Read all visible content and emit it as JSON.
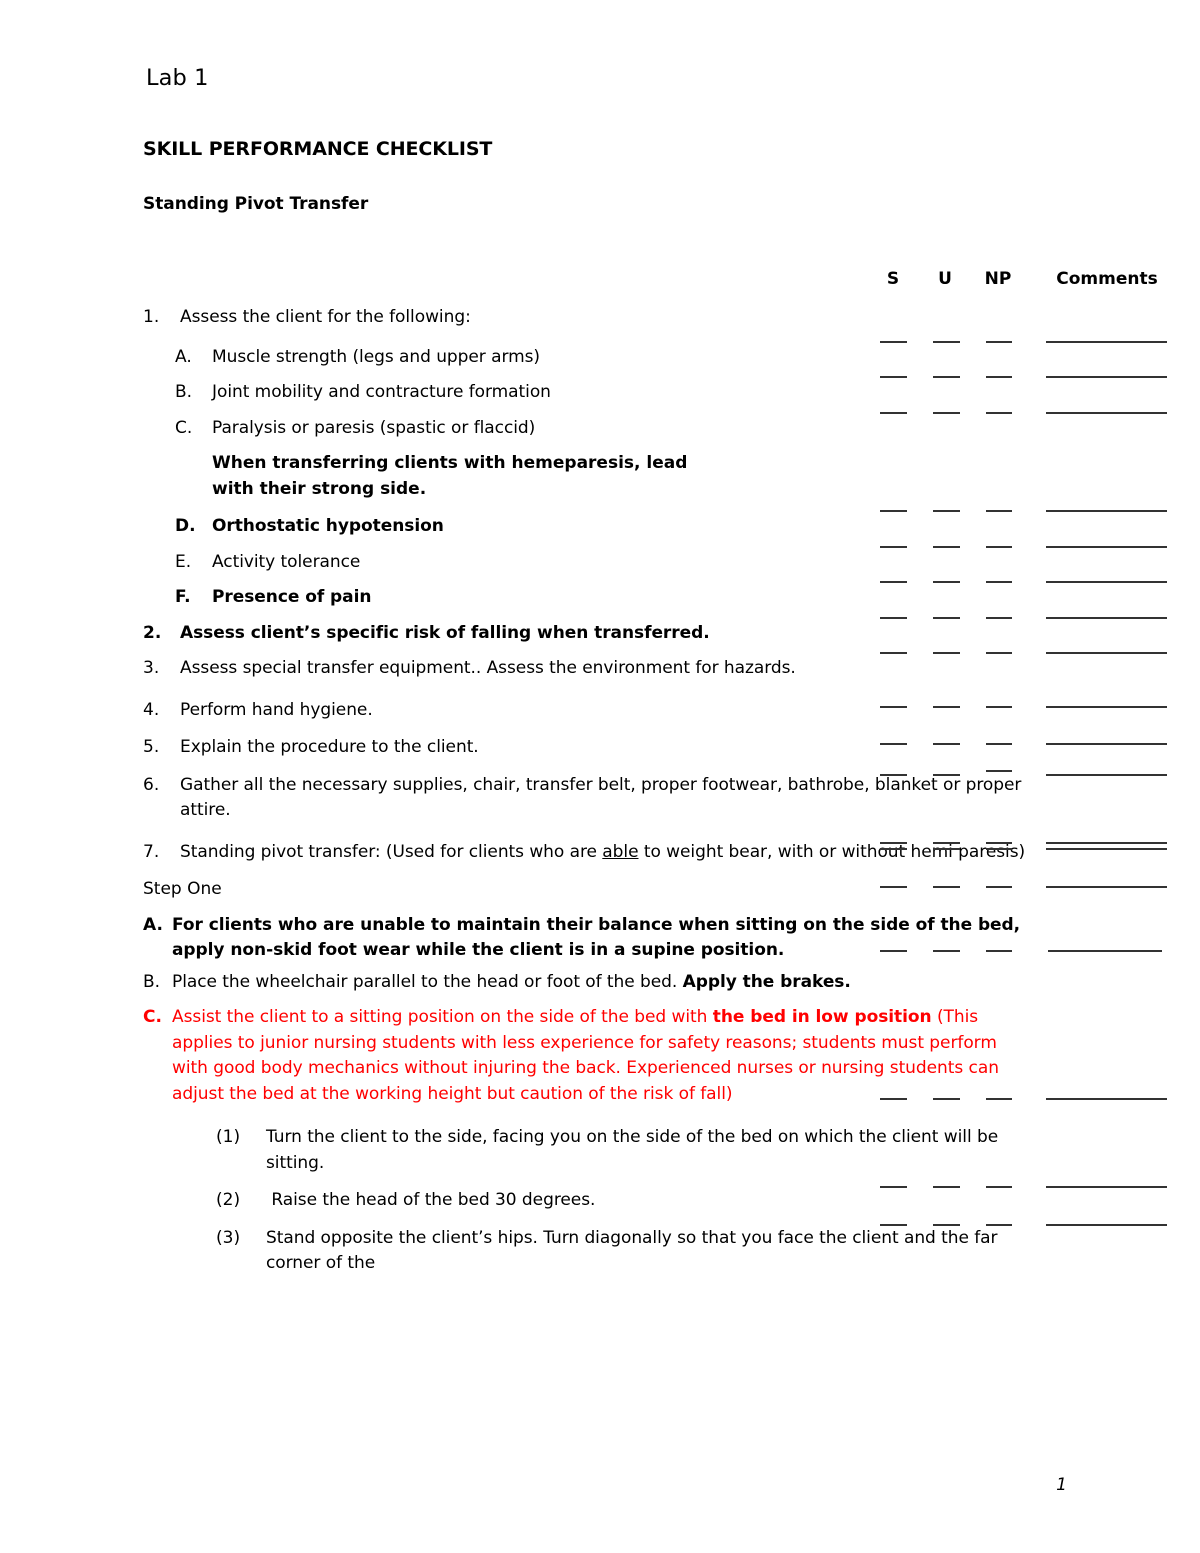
{
  "document": {
    "lab_title": "Lab 1",
    "checklist_title": "SKILL PERFORMANCE CHECKLIST",
    "skill_name": "Standing Pivot Transfer",
    "page_number": "1"
  },
  "columns": {
    "s": "S",
    "u": "U",
    "np": "NP",
    "comments": "Comments"
  },
  "colors": {
    "red_highlight": "#FF0000",
    "text": "#000000",
    "rule": "#333333"
  },
  "items": {
    "n1_marker": "1.",
    "n1_text": "Assess the client for the following:",
    "a_marker": "A.",
    "a_text": "Muscle strength (legs and upper arms)",
    "b_marker": "B.",
    "b_text": "Joint mobility and contracture formation",
    "c_marker": "C.",
    "c_text": "Paralysis or paresis (spastic or flaccid)",
    "c_note": "When transferring clients with hemeparesis, lead with their strong side.",
    "d_marker": "D.",
    "d_text": "Orthostatic hypotension",
    "e_marker": "E.",
    "e_text": "Activity tolerance",
    "f_marker": "F.",
    "f_text": "Presence of pain",
    "n2_marker": "2.",
    "n2_text": "Assess client’s specific risk of falling when transferred.",
    "n3_marker": "3.",
    "n3_text": "Assess special transfer equipment.. Assess the environment for hazards.",
    "n4_marker": "4.",
    "n4_text": "Perform hand hygiene.",
    "n5_marker": "5.",
    "n5_text": "Explain the procedure to the client.",
    "n6_marker": "6.",
    "n6_text": "Gather all the necessary supplies, chair, transfer belt, proper footwear, bathrobe, blanket or proper attire.",
    "n7_marker": "7.",
    "n7_part1": "Standing pivot transfer: (Used for clients who are ",
    "n7_underlined": "able",
    "n7_part2": " to weight bear, with or without hemi paresis)",
    "step_one": "Step One",
    "sa_marker": "A.",
    "sa_text": "For clients who are unable to maintain their balance when sitting on the side of the bed, apply non-skid foot wear while the client is in a supine position.",
    "sb_marker": "B.",
    "sb_text_regular": "Place the wheelchair parallel to the head or foot of the bed. ",
    "sb_text_bold": "Apply the brakes.",
    "sc_marker": "C.",
    "sc_part1": "Assist the client to a sitting position on the side of the bed with ",
    "sc_bold": "the bed in low position",
    "sc_part2": " (This applies to junior nursing students with less experience for safety reasons; students must perform with good body mechanics without injuring the back. Experienced nurses or nursing students can adjust the bed at the working height but caution of the risk of fall)",
    "p1_marker": "(1)",
    "p1_text": "Turn the client to the side, facing you on the side of the bed on which the client will be sitting.",
    "p2_marker": "(2)",
    "p2_text": " Raise the head of the bed 30 degrees.",
    "p3_marker": "(3)",
    "p3_text": "Stand opposite the client’s hips. Turn diagonally so that you face the client and the far corner of the"
  }
}
